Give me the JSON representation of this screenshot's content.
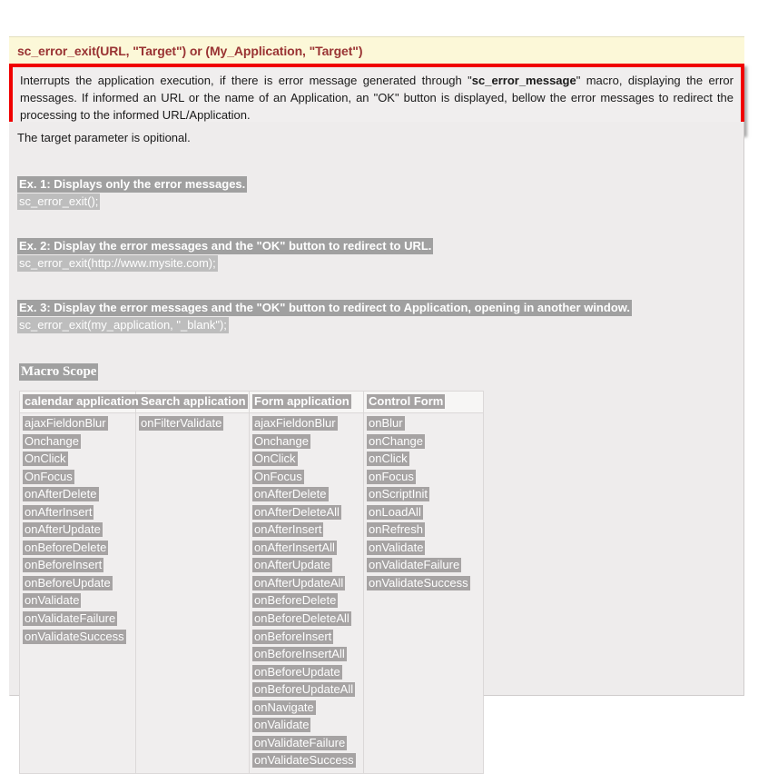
{
  "header": {
    "title": "sc_error_exit(URL, \"Target\") or (My_Application, \"Target\")",
    "bg_color": "#fcf8d8",
    "text_color": "#993333"
  },
  "description": {
    "border_color": "#f00000",
    "part1": "Interrupts the application execution, if there is error message generated through \"",
    "macro_name": "sc_error_message",
    "part2": "\" macro, displaying the error messages. If informed an URL or the name of an Application, an \"OK\" button is displayed, bellow the error messages to redirect the processing to the informed URL/Application."
  },
  "body": {
    "note": "The target parameter is opitional.",
    "examples": [
      {
        "heading": "Ex. 1: Displays only the error messages.",
        "code": "sc_error_exit();"
      },
      {
        "heading": "Ex. 2: Display the error messages and the \"OK\" button to redirect to URL.",
        "code": "sc_error_exit(http://www.mysite.com);"
      },
      {
        "heading": "Ex. 3: Display the error messages and the \"OK\" button to redirect to Application, opening in another window.",
        "code": "sc_error_exit(my_application, \"_blank\");"
      }
    ],
    "scope_title": "Macro Scope",
    "scope_table": {
      "columns": [
        {
          "header": "calendar application",
          "events": [
            "ajaxFieldonBlur",
            "Onchange",
            "OnClick",
            "OnFocus",
            "onAfterDelete",
            "onAfterInsert",
            "onAfterUpdate",
            "onBeforeDelete",
            "onBeforeInsert",
            "onBeforeUpdate",
            "onValidate",
            "onValidateFailure",
            "onValidateSuccess"
          ]
        },
        {
          "header": "Search application",
          "events": [
            "onFilterValidate"
          ]
        },
        {
          "header": "Form application",
          "events": [
            "ajaxFieldonBlur",
            "Onchange",
            "OnClick",
            "OnFocus",
            "onAfterDelete",
            "onAfterDeleteAll",
            "onAfterInsert",
            "onAfterInsertAll",
            "onAfterUpdate",
            "onAfterUpdateAll",
            "onBeforeDelete",
            "onBeforeDeleteAll",
            "onBeforeInsert",
            "onBeforeInsertAll",
            "onBeforeUpdate",
            "onBeforeUpdateAll",
            "onNavigate",
            "onValidate",
            "onValidateFailure",
            "onValidateSuccess"
          ]
        },
        {
          "header": "Control Form",
          "events": [
            "onBlur",
            "onChange",
            "onClick",
            "onFocus",
            "onScriptInit",
            "onLoadAll",
            "onRefresh",
            "onValidate",
            "onValidateFailure",
            "onValidateSuccess"
          ]
        }
      ]
    }
  }
}
